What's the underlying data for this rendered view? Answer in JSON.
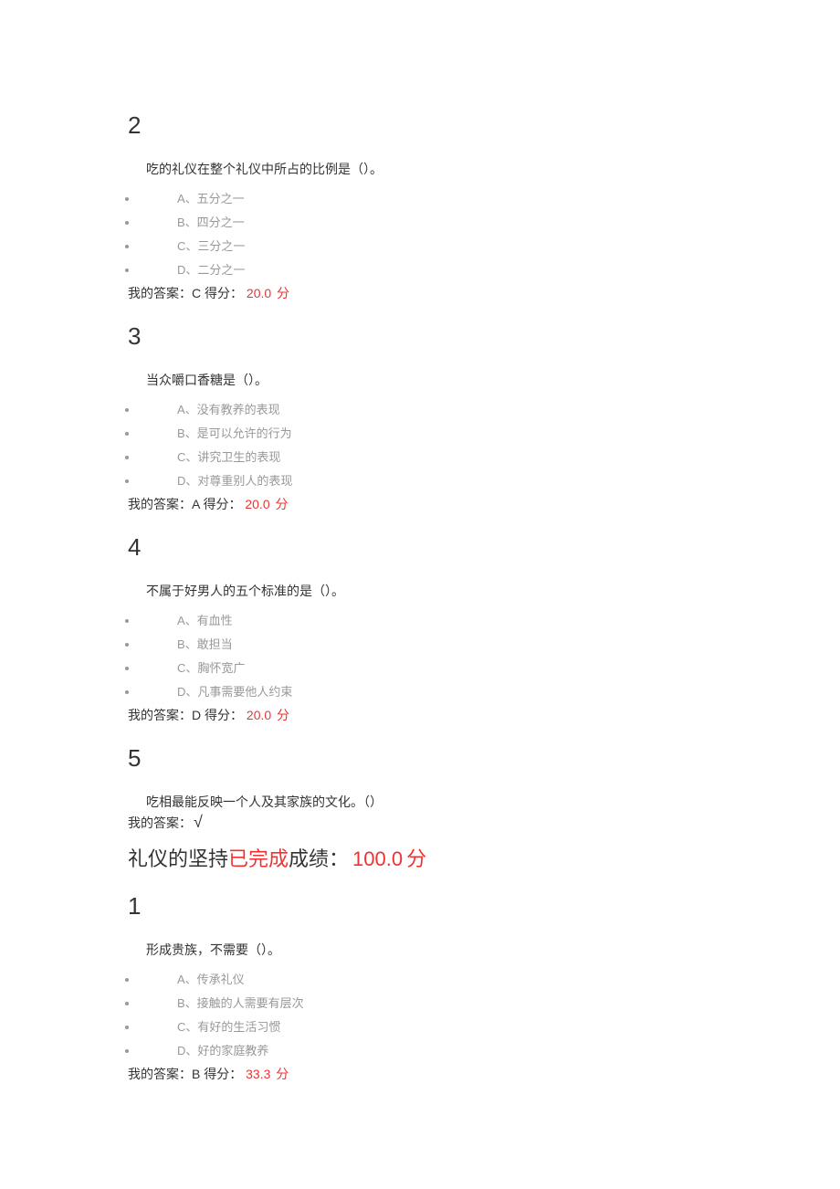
{
  "q2": {
    "num": "2",
    "text": "吃的礼仪在整个礼仪中所占的比例是（）。",
    "opts": [
      "A、五分之一",
      "B、四分之一",
      "C、三分之一",
      "D、二分之一"
    ],
    "ans_label": "我的答案：",
    "ans_letter": "C",
    "score_label": " 得分：",
    "score": "20.0",
    "unit": "分"
  },
  "q3": {
    "num": "3",
    "text": "当众嚼口香糖是（）。",
    "opts": [
      "A、没有教养的表现",
      "B、是可以允许的行为",
      "C、讲究卫生的表现",
      "D、对尊重别人的表现"
    ],
    "ans_label": "我的答案：",
    "ans_letter": "A",
    "score_label": " 得分：",
    "score": "20.0",
    "unit": "分"
  },
  "q4": {
    "num": "4",
    "text": "不属于好男人的五个标准的是（）。",
    "opts": [
      "A、有血性",
      "B、敢担当",
      "C、胸怀宽广",
      "D、凡事需要他人约束"
    ],
    "ans_label": "我的答案：",
    "ans_letter": "D",
    "score_label": " 得分：",
    "score": "20.0",
    "unit": "分"
  },
  "q5": {
    "num": "5",
    "text": "吃相最能反映一个人及其家族的文化。（）",
    "ans_label": "我的答案：",
    "check": "√"
  },
  "section": {
    "title": "礼仪的坚持",
    "done": "已完成",
    "score_label": "成绩：",
    "score": "100.0",
    "unit": "分"
  },
  "q1b": {
    "num": "1",
    "text": "形成贵族，不需要（）。",
    "opts": [
      "A、传承礼仪",
      "B、接触的人需要有层次",
      "C、有好的生活习惯",
      "D、好的家庭教养"
    ],
    "ans_label": "我的答案：",
    "ans_letter": "B",
    "score_label": " 得分：",
    "score": "33.3",
    "unit": "分"
  }
}
